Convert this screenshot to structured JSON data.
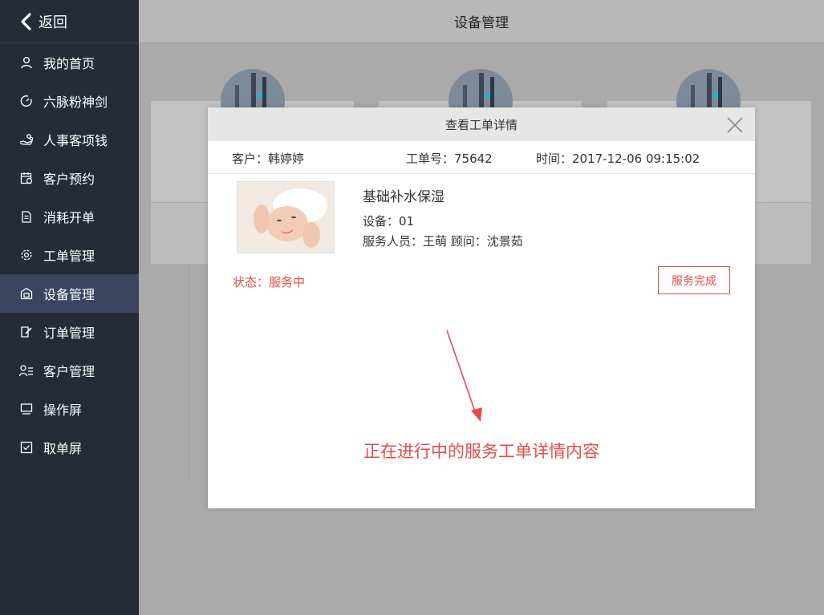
{
  "sidebar": {
    "back_label": "返回",
    "items": [
      {
        "label": "我的首页",
        "icon": "user-icon"
      },
      {
        "label": "六脉粉神剑",
        "icon": "gauge-icon"
      },
      {
        "label": "人事客项钱",
        "icon": "hand-coins-icon"
      },
      {
        "label": "客户预约",
        "icon": "calendar-icon"
      },
      {
        "label": "消耗开单",
        "icon": "document-icon"
      },
      {
        "label": "工单管理",
        "icon": "gear-icon"
      },
      {
        "label": "设备管理",
        "icon": "device-icon"
      },
      {
        "label": "订单管理",
        "icon": "edit-icon"
      },
      {
        "label": "客户管理",
        "icon": "users-list-icon"
      },
      {
        "label": "操作屏",
        "icon": "monitor-icon"
      },
      {
        "label": "取单屏",
        "icon": "checkbox-icon"
      }
    ],
    "active_index": 6
  },
  "header": {
    "title": "设备管理"
  },
  "modal": {
    "title": "查看工单详情",
    "customer": "客户：韩婷婷",
    "order_no": "工单号：75642",
    "time": "时间：2017-12-06 09:15:02",
    "service_name": "基础补水保湿",
    "device": "设备：01",
    "staff": "服务人员：王萌   顾问：沈景茹",
    "status": "状态：服务中",
    "done_button": "服务完成",
    "annotation": "正在进行中的服务工单详情内容"
  },
  "colors": {
    "sidebar_bg": "#252b37",
    "sidebar_active": "#3c4560",
    "accent_red": "#e34d4d"
  }
}
